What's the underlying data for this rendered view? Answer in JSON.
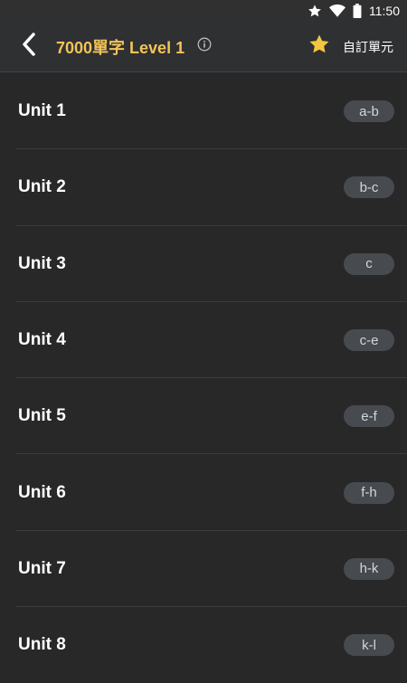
{
  "status_bar": {
    "time": "11:50",
    "icons": [
      "star-icon",
      "wifi-icon",
      "battery-icon"
    ]
  },
  "app_bar": {
    "title": "7000單字 Level 1",
    "custom_unit_label": "自訂單元",
    "icons": [
      "chevron-left-icon",
      "info-icon",
      "star-icon"
    ]
  },
  "colors": {
    "title": "#f2c45a",
    "star": "#f3c63f",
    "background": "#282828",
    "badge": "#474b50"
  },
  "units": [
    {
      "label": "Unit 1",
      "range": "a-b"
    },
    {
      "label": "Unit 2",
      "range": "b-c"
    },
    {
      "label": "Unit 3",
      "range": "c"
    },
    {
      "label": "Unit 4",
      "range": "c-e"
    },
    {
      "label": "Unit 5",
      "range": "e-f"
    },
    {
      "label": "Unit 6",
      "range": "f-h"
    },
    {
      "label": "Unit 7",
      "range": "h-k"
    },
    {
      "label": "Unit 8",
      "range": "k-l"
    }
  ]
}
